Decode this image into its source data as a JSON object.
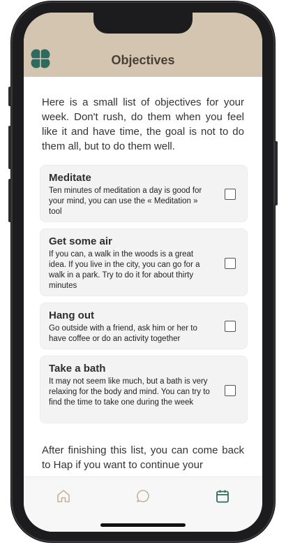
{
  "header": {
    "title": "Objectives"
  },
  "intro": "Here is a small list of objectives for your week. Don't rush, do them when you feel like it and have time, the goal is not to do them all, but to do them well.",
  "objectives": [
    {
      "title": "Meditate",
      "description": "Ten minutes of meditation a day is good for your mind, you can use the « Meditation » tool",
      "checked": false
    },
    {
      "title": "Get some air",
      "description": "If you can, a walk in the woods is a great idea. If you live in the city, you can go for a walk in a park. Try to do it for about thirty minutes",
      "checked": false
    },
    {
      "title": "Hang out",
      "description": "Go outside with a friend, ask him or her to have coffee or do an activity together",
      "checked": false
    },
    {
      "title": "Take a bath",
      "description": "It may not seem like much, but a bath is very relaxing for the body and mind. You can try to find the time to take one during the week",
      "checked": false
    }
  ],
  "outro": "After finishing this list, you can come back to Hap if you want to continue your",
  "tabs": [
    {
      "icon": "home-icon",
      "active": false
    },
    {
      "icon": "chat-bubble-icon",
      "active": false
    },
    {
      "icon": "calendar-icon",
      "active": true
    }
  ],
  "colors": {
    "header": "#d4c5b0",
    "accent": "#2e6b5e",
    "inactive": "#c4b29a"
  }
}
